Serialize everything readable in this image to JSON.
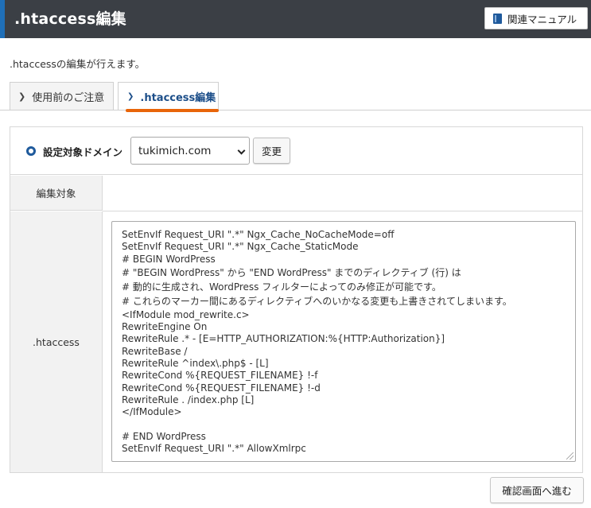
{
  "header": {
    "title": ".htaccess編集",
    "manual_label": "関連マニュアル"
  },
  "description": ".htaccessの編集が行えます。",
  "tabs": [
    {
      "label": "使用前のご注意",
      "active": false
    },
    {
      "label": ".htaccess編集",
      "active": true
    }
  ],
  "domain": {
    "label": "設定対象ドメイン",
    "selected": "tukimich.com",
    "change_label": "変更"
  },
  "rows": {
    "target_label": "編集対象",
    "htaccess_label": ".htaccess"
  },
  "code_lines": [
    "SetEnvIf Request_URI \".*\" Ngx_Cache_NoCacheMode=off",
    "SetEnvIf Request_URI \".*\" Ngx_Cache_StaticMode",
    "# BEGIN WordPress",
    "# \"BEGIN WordPress\" から \"END WordPress\" までのディレクティブ (行) は",
    "# 動的に生成され、WordPress フィルターによってのみ修正が可能です。",
    "# これらのマーカー間にあるディレクティブへのいかなる変更も上書きされてしまいます。",
    "<IfModule mod_rewrite.c>",
    "RewriteEngine On",
    "RewriteRule .* - [E=HTTP_AUTHORIZATION:%{HTTP:Authorization}]",
    "RewriteBase /",
    "RewriteRule ^index\\.php$ - [L]",
    "RewriteCond %{REQUEST_FILENAME} !-f",
    "RewriteCond %{REQUEST_FILENAME} !-d",
    "RewriteRule . /index.php [L]",
    "</IfModule>",
    "",
    "# END WordPress",
    "SetEnvIf Request_URI \".*\" AllowXmlrpc"
  ],
  "confirm_label": "確認画面へ進む",
  "colors": {
    "header_bg": "#3b3f45",
    "header_accent": "#1f6fb8",
    "tab_active_underline": "#e8650a",
    "brand_blue": "#1f5a9c"
  },
  "icons": {
    "manual": "book-icon",
    "domain_radio": "radio-icon",
    "tab_chevron": "chevron-icon"
  }
}
